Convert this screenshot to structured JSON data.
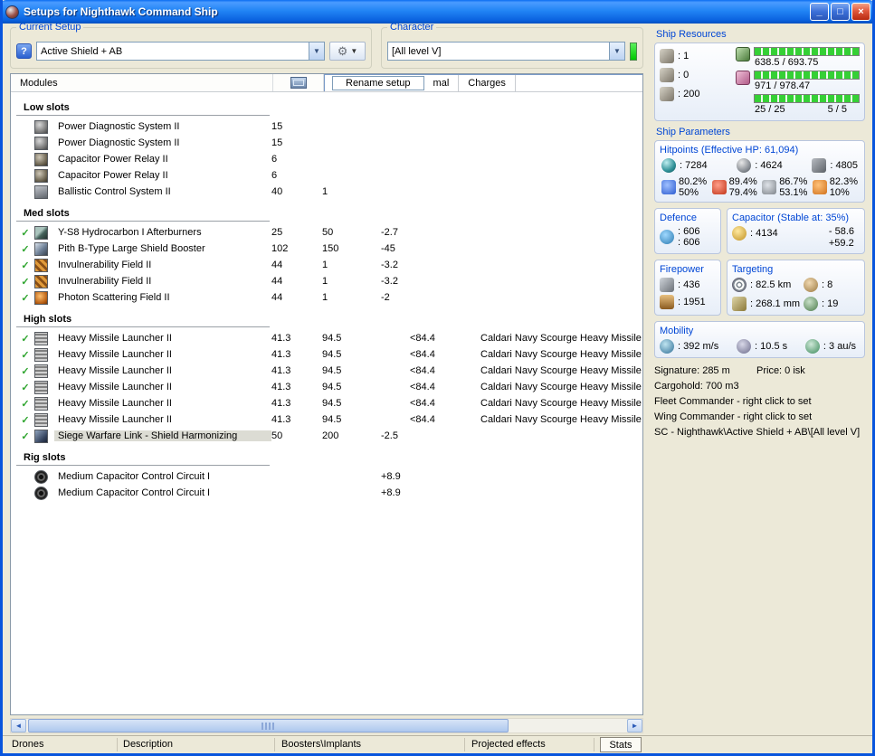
{
  "window": {
    "title": "Setups for Nighthawk Command Ship",
    "controls": {
      "minimize": "_",
      "maximize": "□",
      "close": "×"
    }
  },
  "top": {
    "current_setup": {
      "label": "Current Setup",
      "value": "Active Shield + AB"
    },
    "character": {
      "label": "Character",
      "value": "[All level V]"
    }
  },
  "list_header": {
    "modules_label": "Modules",
    "tabs": [
      "Rename setup",
      "mal",
      "Charges"
    ]
  },
  "sections": [
    {
      "title": "Low slots",
      "rows": [
        {
          "checked": false,
          "icon": "pds-icon",
          "name": "Power Diagnostic System II",
          "c1": "15",
          "c2": "",
          "c3": "",
          "c4": "",
          "charge": ""
        },
        {
          "checked": false,
          "icon": "pds-icon",
          "name": "Power Diagnostic System II",
          "c1": "15",
          "c2": "",
          "c3": "",
          "c4": "",
          "charge": ""
        },
        {
          "checked": false,
          "icon": "cap-relay-icon",
          "name": "Capacitor Power Relay II",
          "c1": "6",
          "c2": "",
          "c3": "",
          "c4": "",
          "charge": ""
        },
        {
          "checked": false,
          "icon": "cap-relay-icon",
          "name": "Capacitor Power Relay II",
          "c1": "6",
          "c2": "",
          "c3": "",
          "c4": "",
          "charge": ""
        },
        {
          "checked": false,
          "icon": "bcs-icon",
          "name": "Ballistic Control System II",
          "c1": "40",
          "c2": "1",
          "c3": "",
          "c4": "",
          "charge": ""
        }
      ]
    },
    {
      "title": "Med slots",
      "rows": [
        {
          "checked": true,
          "icon": "afterburner-icon",
          "name": "Y-S8 Hydrocarbon I Afterburners",
          "c1": "25",
          "c2": "50",
          "c3": "-2.7",
          "c4": "",
          "charge": ""
        },
        {
          "checked": true,
          "icon": "shield-booster-icon",
          "name": "Pith B-Type Large Shield Booster",
          "c1": "102",
          "c2": "150",
          "c3": "-45",
          "c4": "",
          "charge": ""
        },
        {
          "checked": true,
          "icon": "invuln-icon",
          "name": "Invulnerability Field II",
          "c1": "44",
          "c2": "1",
          "c3": "-3.2",
          "c4": "",
          "charge": ""
        },
        {
          "checked": true,
          "icon": "invuln-icon",
          "name": "Invulnerability Field II",
          "c1": "44",
          "c2": "1",
          "c3": "-3.2",
          "c4": "",
          "charge": ""
        },
        {
          "checked": true,
          "icon": "photon-icon",
          "name": "Photon Scattering Field II",
          "c1": "44",
          "c2": "1",
          "c3": "-2",
          "c4": "",
          "charge": ""
        }
      ]
    },
    {
      "title": "High slots",
      "rows": [
        {
          "checked": true,
          "icon": "missile-launcher-icon",
          "name": "Heavy Missile Launcher II",
          "c1": "41.3",
          "c2": "94.5",
          "c3": "",
          "c4": "<84.4",
          "charge": "Caldari Navy Scourge Heavy Missile"
        },
        {
          "checked": true,
          "icon": "missile-launcher-icon",
          "name": "Heavy Missile Launcher II",
          "c1": "41.3",
          "c2": "94.5",
          "c3": "",
          "c4": "<84.4",
          "charge": "Caldari Navy Scourge Heavy Missile"
        },
        {
          "checked": true,
          "icon": "missile-launcher-icon",
          "name": "Heavy Missile Launcher II",
          "c1": "41.3",
          "c2": "94.5",
          "c3": "",
          "c4": "<84.4",
          "charge": "Caldari Navy Scourge Heavy Missile"
        },
        {
          "checked": true,
          "icon": "missile-launcher-icon",
          "name": "Heavy Missile Launcher II",
          "c1": "41.3",
          "c2": "94.5",
          "c3": "",
          "c4": "<84.4",
          "charge": "Caldari Navy Scourge Heavy Missile"
        },
        {
          "checked": true,
          "icon": "missile-launcher-icon",
          "name": "Heavy Missile Launcher II",
          "c1": "41.3",
          "c2": "94.5",
          "c3": "",
          "c4": "<84.4",
          "charge": "Caldari Navy Scourge Heavy Missile"
        },
        {
          "checked": true,
          "icon": "missile-launcher-icon",
          "name": "Heavy Missile Launcher II",
          "c1": "41.3",
          "c2": "94.5",
          "c3": "",
          "c4": "<84.4",
          "charge": "Caldari Navy Scourge Heavy Missile"
        },
        {
          "checked": true,
          "icon": "siege-link-icon",
          "name": "Siege Warfare Link - Shield Harmonizing",
          "c1": "50",
          "c2": "200",
          "c3": "-2.5",
          "c4": "",
          "charge": "",
          "selected": true
        }
      ]
    },
    {
      "title": "Rig slots",
      "rows": [
        {
          "checked": false,
          "icon": "cap-circuit-icon",
          "name": "Medium Capacitor Control Circuit I",
          "c1": "",
          "c2": "",
          "c3": "+8.9",
          "c4": "",
          "charge": ""
        },
        {
          "checked": false,
          "icon": "cap-circuit-icon",
          "name": "Medium Capacitor Control Circuit I",
          "c1": "",
          "c2": "",
          "c3": "+8.9",
          "c4": "",
          "charge": ""
        }
      ]
    }
  ],
  "right": {
    "resources": {
      "label": "Ship Resources",
      "turrets": ": 1",
      "launchers": ": 0",
      "drones": ": 200",
      "cpu": "638.5 / 693.75",
      "powergrid": "971 / 978.47",
      "calibration": "25 / 25",
      "rigs": "5 / 5"
    },
    "parameters_label": "Ship Parameters",
    "hitpoints": {
      "title": "Hitpoints (Effective HP: 61,094)",
      "shield": ": 7284",
      "armor": ": 4624",
      "hull": ": 4805",
      "resists": [
        {
          "top": "80.2%",
          "bottom": "50%"
        },
        {
          "top": "89.4%",
          "bottom": "79.4%"
        },
        {
          "top": "86.7%",
          "bottom": "53.1%"
        },
        {
          "top": "82.3%",
          "bottom": "10%"
        }
      ]
    },
    "defence": {
      "title": "Defence",
      "v1": ": 606",
      "v2": ": 606"
    },
    "capacitor": {
      "title": "Capacitor (Stable at: 35%)",
      "v1": ": 4134",
      "v2": "- 58.6",
      "v3": "+59.2"
    },
    "firepower": {
      "title": "Firepower",
      "v1": ": 436",
      "v2": ": 1951"
    },
    "targeting": {
      "title": "Targeting",
      "v1": ": 82.5 km",
      "v2": ": 8",
      "v3": ": 268.1 mm",
      "v4": ": 19"
    },
    "mobility": {
      "title": "Mobility",
      "v1": ": 392 m/s",
      "v2": ": 10.5 s",
      "v3": ": 3 au/s"
    },
    "info": {
      "signature": "Signature: 285 m",
      "price": "Price: 0 isk",
      "cargohold": "Cargohold: 700 m3",
      "fleet": "Fleet Commander - right click to set",
      "wing": "Wing Commander - right click to set",
      "path": "SC - Nighthawk\\Active Shield + AB\\[All level V]"
    }
  },
  "bottom_tabs": [
    "Drones",
    "Description",
    "Boosters\\Implants",
    "Projected effects",
    "Stats"
  ]
}
